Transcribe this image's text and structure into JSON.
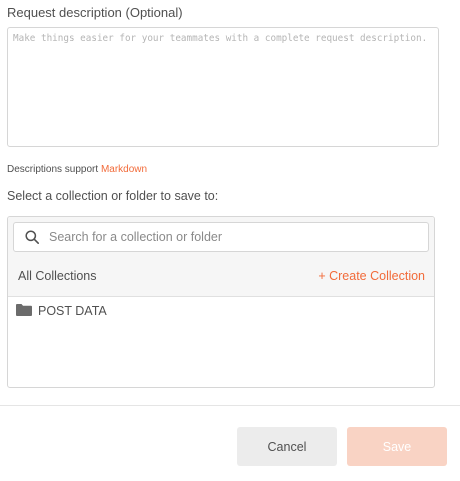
{
  "description": {
    "label": "Request description (Optional)",
    "placeholder": "Make things easier for your teammates with a complete request description.",
    "value": ""
  },
  "markdown_note": {
    "prefix": "Descriptions support ",
    "link": "Markdown"
  },
  "collection_select": {
    "label": "Select a collection or folder to save to:",
    "search_placeholder": "Search for a collection or folder",
    "header_label": "All Collections",
    "create_label": "+ Create Collection",
    "items": [
      {
        "icon": "folder-icon",
        "label": "POST DATA"
      }
    ]
  },
  "footer": {
    "cancel_label": "Cancel",
    "save_label": "Save",
    "save_disabled": true
  },
  "colors": {
    "accent": "#f26b3a",
    "save_disabled_bg": "#f9d3c4"
  }
}
